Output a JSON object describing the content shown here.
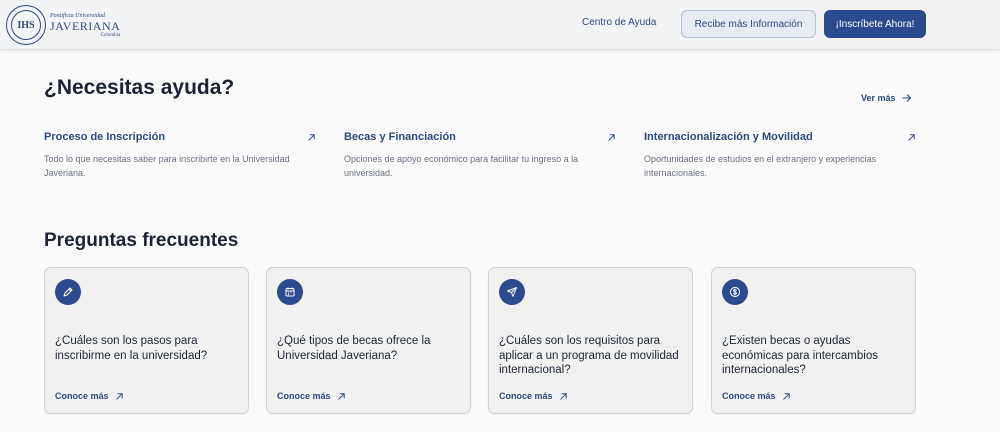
{
  "header": {
    "logo": {
      "line1": "Pontificia Universidad",
      "line2": "JAVERIANA",
      "line3": "Colombia",
      "seal": "IHS"
    },
    "help_center": "Centro de Ayuda",
    "info_button": "Recibe más Información",
    "signup_button": "¡Inscríbete Ahora!"
  },
  "help": {
    "title": "¿Necesitas ayuda?",
    "see_more": "Ver más",
    "items": [
      {
        "title": "Proceso de Inscripción",
        "desc": "Todo lo que necesitas saber para inscribirte en la Universidad Javeriana."
      },
      {
        "title": "Becas y Financiación",
        "desc": "Opciones de apoyo económico para facilitar tu ingreso a la universidad."
      },
      {
        "title": "Internacionalización y Movilidad",
        "desc": "Oportunidades de estudios en el extranjero y experiencias internacionales."
      }
    ]
  },
  "faq": {
    "title": "Preguntas frecuentes",
    "cards": [
      {
        "icon": "edit-icon",
        "question": "¿Cuáles son los pasos para inscribirme en la universidad?",
        "link": "Conoce más"
      },
      {
        "icon": "calendar-icon",
        "question": "¿Qué tipos de becas ofrece la Universidad Javeriana?",
        "link": "Conoce más"
      },
      {
        "icon": "send-icon",
        "question": "¿Cuáles son los requisitos para aplicar a un programa de movilidad internacional?",
        "link": "Conoce más"
      },
      {
        "icon": "dollar-icon",
        "question": "¿Existen becas o ayudas económicas para intercambios internacionales?",
        "link": "Conoce más"
      }
    ]
  },
  "colors": {
    "primary": "#2c4a8e",
    "link": "#2c4a7a",
    "text": "#1c2433",
    "muted": "#6b7280"
  }
}
